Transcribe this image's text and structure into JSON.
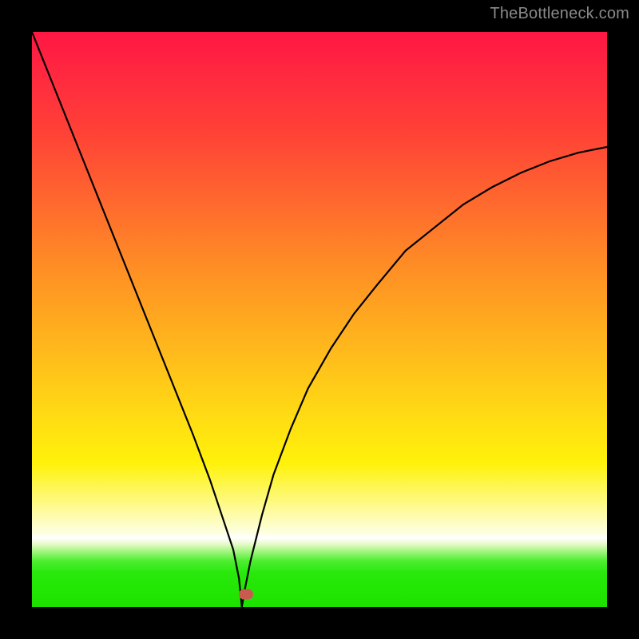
{
  "watermark": "TheBottleneck.com",
  "colors": {
    "frame": "#000000",
    "curve_stroke": "#000000",
    "marker_fill": "#c95a4f",
    "watermark_text": "#8a8a8a"
  },
  "marker": {
    "x_percent": 37.2,
    "y_percent": 97.8
  },
  "chart_data": {
    "type": "line",
    "title": "",
    "xlabel": "",
    "ylabel": "",
    "xlim": [
      0,
      100
    ],
    "ylim": [
      0,
      100
    ],
    "grid": false,
    "legend": false,
    "note": "V-shaped bottleneck curve. Values estimated from pixel positions; axes unlabeled.",
    "minimum_x": 36.5,
    "marker_x": 37.2,
    "series": [
      {
        "name": "bottleneck-curve",
        "x": [
          0,
          4,
          8,
          12,
          16,
          20,
          24,
          28,
          31,
          33,
          35,
          36,
          36.5,
          37,
          38,
          40,
          42,
          45,
          48,
          52,
          56,
          60,
          65,
          70,
          75,
          80,
          85,
          90,
          95,
          100
        ],
        "y": [
          100,
          90,
          80,
          70,
          60,
          50,
          40,
          30,
          22,
          16,
          10,
          5,
          0,
          3,
          8,
          16,
          23,
          31,
          38,
          45,
          51,
          56,
          62,
          66,
          70,
          73,
          75.5,
          77.5,
          79,
          80
        ]
      }
    ]
  }
}
